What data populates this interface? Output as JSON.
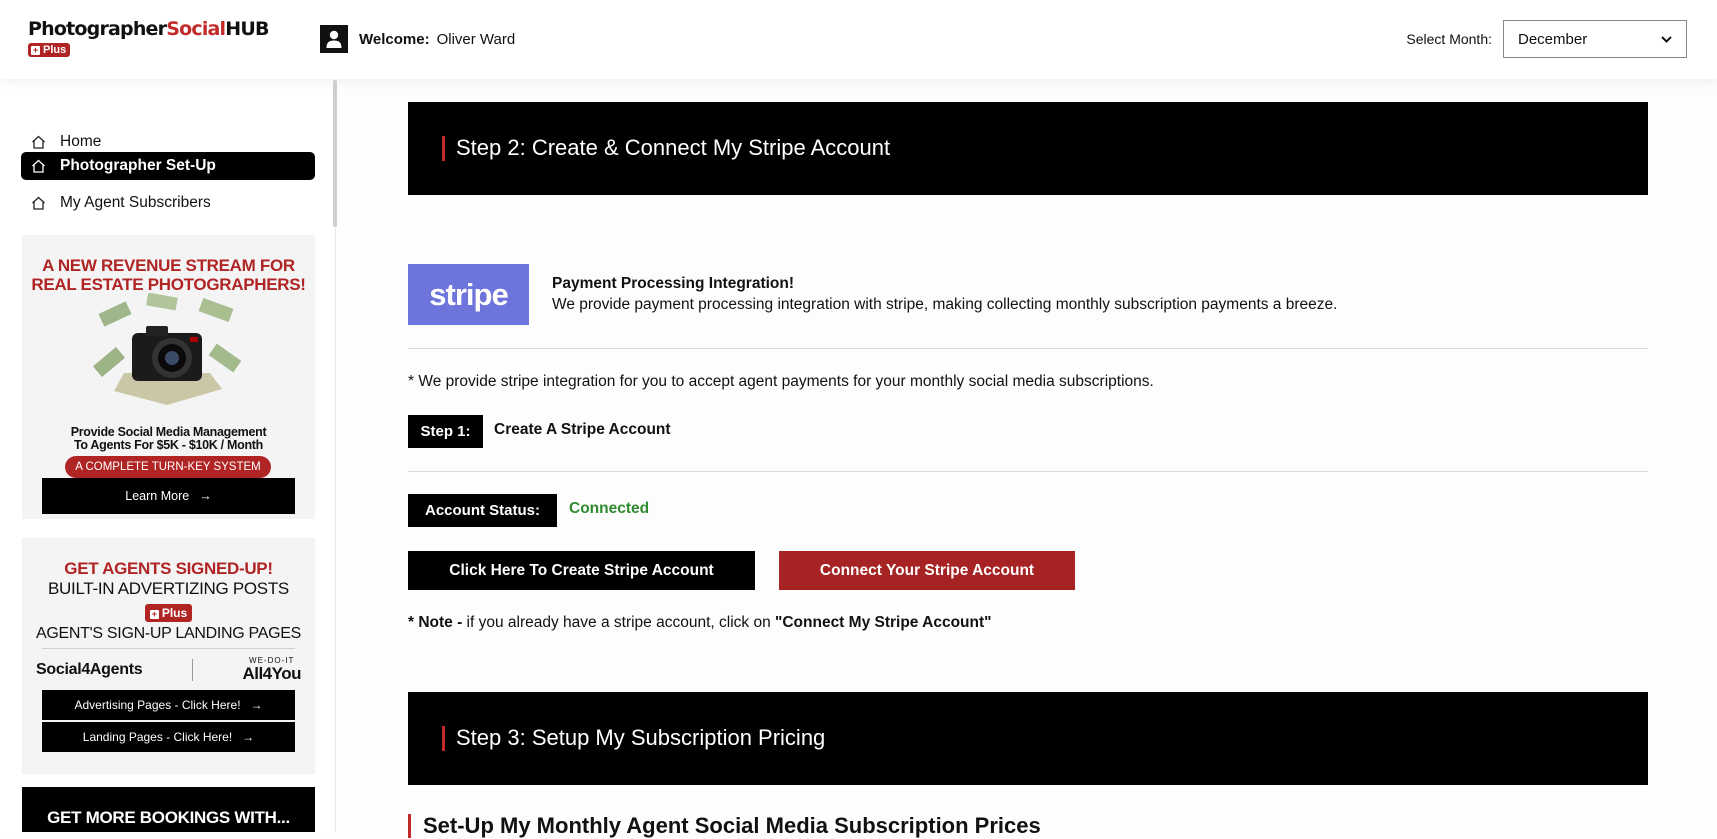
{
  "logo": {
    "part1": "Photographer",
    "part2": "Social",
    "part3": "HUB",
    "plus": "Plus"
  },
  "header": {
    "welcome_label": "Welcome:",
    "user_name": "Oliver Ward",
    "select_label": "Select Month:",
    "selected_month": "December"
  },
  "sidebar": {
    "items": [
      {
        "label": "Home",
        "icon": "home-icon"
      },
      {
        "label": "Photographer Set-Up",
        "icon": "home-icon"
      },
      {
        "label": "My Agent Subscribers",
        "icon": "home-icon"
      }
    ],
    "promo1": {
      "line1": "A NEW REVENUE STREAM FOR",
      "line2": "REAL ESTATE PHOTOGRAPHERS!",
      "sub1": "Provide Social Media Management",
      "sub2": "To Agents For $5K - $10K / Month",
      "pill": "A COMPLETE TURN-KEY SYSTEM",
      "button": "Learn More"
    },
    "promo2": {
      "line1": "GET AGENTS SIGNED-UP!",
      "line2": "BUILT-IN ADVERTIZING POSTS",
      "plus": "Plus",
      "line3": "AGENT'S SIGN-UP LANDING PAGES",
      "brand1": "Social4Agents",
      "brand2_top": "WE-DO-IT",
      "brand2": "All4You",
      "btn1": "Advertising Pages - Click Here!",
      "btn2": "Landing Pages - Click Here!"
    },
    "promo3": {
      "line1": "GET MORE BOOKINGS WITH..."
    }
  },
  "main": {
    "step2_title": "Step 2: Create & Connect My Stripe Account",
    "stripe_logo": "stripe",
    "ppi_title": "Payment Processing Integration!",
    "ppi_desc": "We provide payment processing integration with stripe, making collecting monthly subscription payments a breeze.",
    "note1": "* We provide stripe integration for you to accept agent payments for your monthly social media subscriptions.",
    "step1_tag": "Step 1:",
    "step1_text": "Create A Stripe Account",
    "status_tag": "Account Status:",
    "status_value": "Connected",
    "btn_create": "Click Here To Create Stripe Account",
    "btn_connect": "Connect Your Stripe Account",
    "note2_prefix": "* Note -",
    "note2_mid": " if you already have a stripe account, click on ",
    "note2_bold": "\"Connect My Stripe Account\"",
    "step3_title": "Step 3: Setup My Subscription Pricing",
    "subheading": "Set-Up My Monthly Agent Social Media Subscription Prices"
  },
  "colors": {
    "accent_red": "#c22a2a",
    "button_red": "#a72222",
    "stripe_purple": "#6d74db",
    "status_green": "#2e8b2e"
  }
}
